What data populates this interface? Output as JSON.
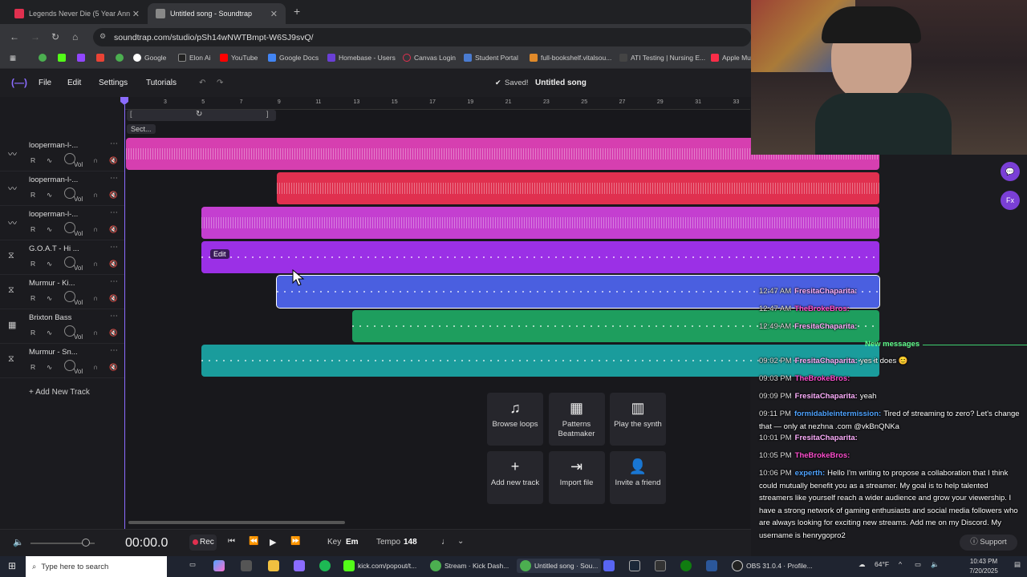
{
  "browser": {
    "tabs": [
      {
        "label": "Legends Never Die (5 Year Ann",
        "active": false
      },
      {
        "label": "Untitled song - Soundtrap",
        "active": true
      }
    ],
    "url": "soundtrap.com/studio/pSh14wNWTBmpt-W6SJ9svQ/",
    "bookmarks": [
      "Google",
      "Elon Ai",
      "YouTube",
      "Google Docs",
      "Homebase - Users",
      "Canvas Login",
      "Student Portal",
      "full-bookshelf.vitalsou...",
      "ATI Testing | Nursing E...",
      "Apple Mu"
    ]
  },
  "app": {
    "menu": {
      "file": "File",
      "edit": "Edit",
      "settings": "Settings",
      "tutorials": "Tutorials"
    },
    "saved_status": "Saved!",
    "song_title": "Untitled song",
    "ruler_ticks": [
      "3",
      "5",
      "7",
      "9",
      "11",
      "13",
      "15",
      "17",
      "19",
      "21",
      "23",
      "25",
      "27",
      "29",
      "31",
      "33"
    ],
    "section_label": "Sect...",
    "edit_label": "Edit",
    "add_track": "+ Add New Track",
    "tracks": [
      {
        "name": "looperman-l-...",
        "icon": "waveform-icon",
        "color": "#d63fb0",
        "kind": "audio",
        "start": 0.0,
        "end": 1.0
      },
      {
        "name": "looperman-l-...",
        "icon": "waveform-icon",
        "color": "#e0304f",
        "kind": "audio",
        "start": 0.2,
        "end": 1.0
      },
      {
        "name": "looperman-l-...",
        "icon": "waveform-icon",
        "color": "#c43fd0",
        "kind": "audio",
        "start": 0.1,
        "end": 1.0
      },
      {
        "name": "G.O.A.T - Hi ...",
        "icon": "drum-icon",
        "color": "#9b30e6",
        "kind": "midi",
        "start": 0.1,
        "end": 1.0
      },
      {
        "name": "Murmur - Ki...",
        "icon": "drum-icon",
        "color": "#4a5fe0",
        "kind": "midi",
        "start": 0.2,
        "end": 1.0
      },
      {
        "name": "Brixton Bass",
        "icon": "synth-icon",
        "color": "#1e9e5e",
        "kind": "midi",
        "start": 0.3,
        "end": 1.0
      },
      {
        "name": "Murmur - Sn...",
        "icon": "drum-icon",
        "color": "#1a9c9c",
        "kind": "midi",
        "start": 0.1,
        "end": 1.0
      }
    ],
    "track_controls": {
      "r": "R",
      "vol": "Vol"
    },
    "cards": [
      {
        "label": "Browse loops",
        "icon": "music-note-icon"
      },
      {
        "label": "Patterns Beatmaker",
        "icon": "grid-icon"
      },
      {
        "label": "Play the synth",
        "icon": "piano-icon"
      },
      {
        "label": "Add new track",
        "icon": "plus-icon"
      },
      {
        "label": "Import file",
        "icon": "import-icon"
      },
      {
        "label": "Invite a friend",
        "icon": "invite-icon"
      }
    ],
    "transport": {
      "time": "00:00.0",
      "rec": "Rec",
      "key_label": "Key",
      "key_value": "Em",
      "tempo_label": "Tempo",
      "tempo_value": "148"
    },
    "side_buttons": {
      "chat": "chat-icon",
      "fx": "Fx"
    }
  },
  "chat": {
    "new_messages": "New messages",
    "messages": [
      {
        "time": "12:47 AM",
        "user": "FresitaChaparita:",
        "color": "#ffb0ff",
        "text": ""
      },
      {
        "time": "12:47 AM",
        "user": "TheBrokeBros:",
        "color": "#ff4fd0",
        "text": ""
      },
      {
        "time": "12:49 AM",
        "user": "FresitaChaparita:",
        "color": "#ffb0ff",
        "text": ""
      },
      {
        "time": "09:02 PM",
        "user": "FresitaChaparita:",
        "color": "#ffb0ff",
        "text": "yes it does 😊"
      },
      {
        "time": "09:03 PM",
        "user": "TheBrokeBros:",
        "color": "#ff4fd0",
        "text": ""
      },
      {
        "time": "09:09 PM",
        "user": "FresitaChaparita:",
        "color": "#ffb0ff",
        "text": "yeah"
      },
      {
        "time": "09:11 PM",
        "user": "formidableintermission:",
        "color": "#4fa3ff",
        "text": "Tired of streaming to zero? Let's change that — only at nezhna .com @vkBnQNKa"
      },
      {
        "time": "10:01 PM",
        "user": "FresitaChaparita:",
        "color": "#ffb0ff",
        "text": ""
      },
      {
        "time": "10:05 PM",
        "user": "TheBrokeBros:",
        "color": "#ff4fd0",
        "text": ""
      },
      {
        "time": "10:06 PM",
        "user": "experth:",
        "color": "#4fa3ff",
        "text": "Hello I'm writing to propose a collaboration that I think could mutually benefit you as a streamer. My goal is to help talented streamers like yourself reach a wider audience and grow your viewership. I have a strong network of gaming enthusiasts and social media followers who are always looking for exciting new streams. Add me on my Discord. My username is henrygopro2"
      }
    ],
    "support": "Support"
  },
  "taskbar": {
    "search": "Type here to search",
    "items": [
      "kick.com/popout/t...",
      "Stream · Kick Dash...",
      "Untitled song · Sou...",
      "OBS 31.0.4 · Profile..."
    ],
    "weather": "64°F",
    "time": "10:43 PM",
    "date": "7/20/2025"
  }
}
